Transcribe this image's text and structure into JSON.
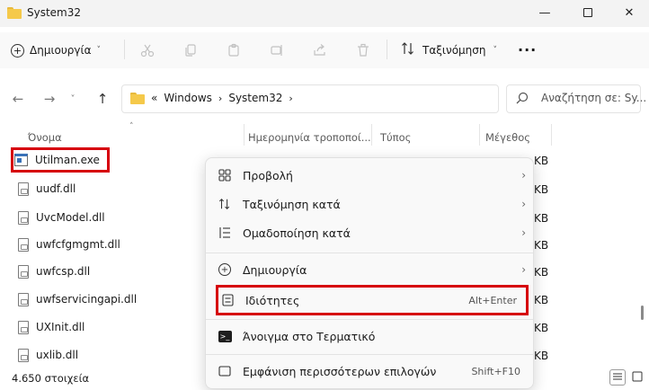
{
  "window": {
    "title": "System32",
    "controls": [
      "minimize-icon",
      "maximize-icon",
      "close-icon"
    ]
  },
  "toolbar": {
    "new_label": "Δημιουργία",
    "sort_label": "Ταξινόμηση",
    "more_label": "···",
    "icons": [
      "cut-icon",
      "copy-icon",
      "paste-icon",
      "rename-icon",
      "share-icon",
      "delete-icon"
    ]
  },
  "address": {
    "overflow": "«",
    "crumbs": [
      "Windows",
      "System32"
    ],
    "search_placeholder": "Αναζήτηση σε: Sy..."
  },
  "columns": {
    "name": "Όνομα",
    "date": "Ημερομηνία τροποποί...",
    "type": "Τύπος",
    "size": "Μέγεθος"
  },
  "files": [
    {
      "name": "Utilman.exe",
      "size": "KB"
    },
    {
      "name": "uudf.dll",
      "size": "KB"
    },
    {
      "name": "UvcModel.dll",
      "size": "KB"
    },
    {
      "name": "uwfcfgmgmt.dll",
      "size": "KB"
    },
    {
      "name": "uwfcsp.dll",
      "size": "KB"
    },
    {
      "name": "uwfservicingapi.dll",
      "size": "KB"
    },
    {
      "name": "UXInit.dll",
      "size": "KB"
    },
    {
      "name": "uxlib.dll",
      "size": "KB"
    }
  ],
  "menu": {
    "view": "Προβολή",
    "sort_by": "Ταξινόμηση κατά",
    "group_by": "Ομαδοποίηση κατά",
    "new": "Δημιουργία",
    "properties": "Ιδιότητες",
    "properties_shortcut": "Alt+Enter",
    "open_terminal": "Άνοιγμα στο Τερματικό",
    "more_options": "Εμφάνιση περισσότερων επιλογών",
    "more_options_shortcut": "Shift+F10"
  },
  "status": {
    "count": "4.650 στοιχεία"
  },
  "colors": {
    "highlight": "#d6000c",
    "folder": "#f5c94a",
    "menu_bg": "#f9f9f9"
  }
}
